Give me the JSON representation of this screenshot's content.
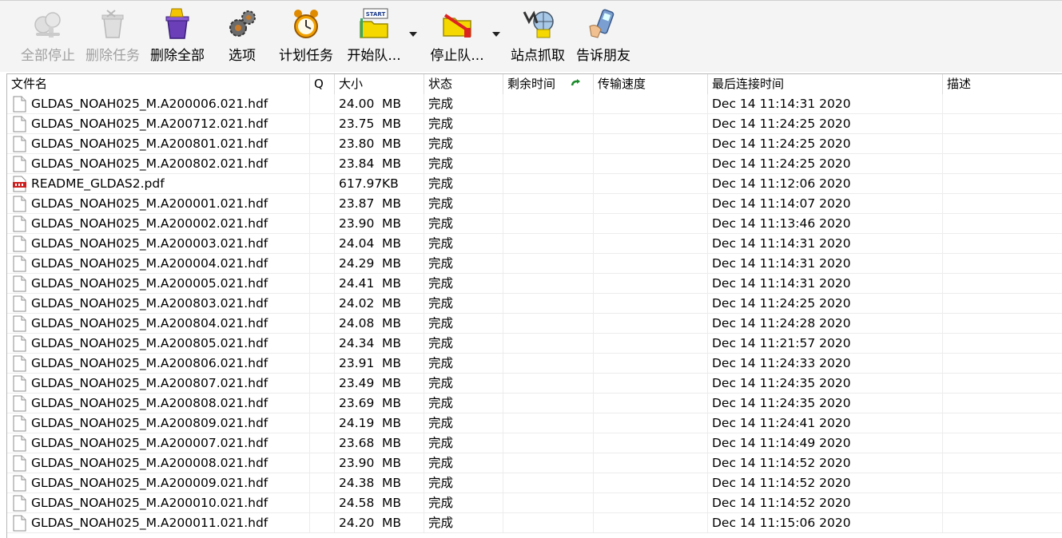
{
  "toolbar": {
    "buttons": [
      {
        "label": "全部停止",
        "icon": "stop-all-icon",
        "disabled": true
      },
      {
        "label": "删除任务",
        "icon": "delete-task-icon",
        "disabled": true
      },
      {
        "label": "删除全部",
        "icon": "delete-all-icon",
        "disabled": false
      },
      {
        "label": "选项",
        "icon": "options-gear-icon",
        "disabled": false
      },
      {
        "label": "计划任务",
        "icon": "scheduler-clock-icon",
        "disabled": false
      },
      {
        "label": "开始队...",
        "icon": "start-queue-icon",
        "disabled": false
      },
      {
        "label": "停止队...",
        "icon": "stop-queue-icon",
        "disabled": false
      },
      {
        "label": "站点抓取",
        "icon": "site-grabber-icon",
        "disabled": false
      },
      {
        "label": "告诉朋友",
        "icon": "tell-friend-icon",
        "disabled": false
      }
    ],
    "start_icon_text": "START"
  },
  "table": {
    "headers": {
      "name": "文件名",
      "q": "Q",
      "size": "大小",
      "status": "状态",
      "remaining": "剩余时间",
      "speed": "传输速度",
      "last": "最后连接时间",
      "desc": "描述"
    },
    "rows": [
      {
        "name": "GLDAS_NOAH025_M.A200006.021.hdf",
        "type": "file",
        "size": "24.00",
        "unit": "MB",
        "status": "完成",
        "last": "Dec 14 11:14:31 2020"
      },
      {
        "name": "GLDAS_NOAH025_M.A200712.021.hdf",
        "type": "file",
        "size": "23.75",
        "unit": "MB",
        "status": "完成",
        "last": "Dec 14 11:24:25 2020"
      },
      {
        "name": "GLDAS_NOAH025_M.A200801.021.hdf",
        "type": "file",
        "size": "23.80",
        "unit": "MB",
        "status": "完成",
        "last": "Dec 14 11:24:25 2020"
      },
      {
        "name": "GLDAS_NOAH025_M.A200802.021.hdf",
        "type": "file",
        "size": "23.84",
        "unit": "MB",
        "status": "完成",
        "last": "Dec 14 11:24:25 2020"
      },
      {
        "name": "README_GLDAS2.pdf",
        "type": "pdf",
        "size": "617.97",
        "unit": "KB",
        "status": "完成",
        "last": "Dec 14 11:12:06 2020"
      },
      {
        "name": "GLDAS_NOAH025_M.A200001.021.hdf",
        "type": "file",
        "size": "23.87",
        "unit": "MB",
        "status": "完成",
        "last": "Dec 14 11:14:07 2020"
      },
      {
        "name": "GLDAS_NOAH025_M.A200002.021.hdf",
        "type": "file",
        "size": "23.90",
        "unit": "MB",
        "status": "完成",
        "last": "Dec 14 11:13:46 2020"
      },
      {
        "name": "GLDAS_NOAH025_M.A200003.021.hdf",
        "type": "file",
        "size": "24.04",
        "unit": "MB",
        "status": "完成",
        "last": "Dec 14 11:14:31 2020"
      },
      {
        "name": "GLDAS_NOAH025_M.A200004.021.hdf",
        "type": "file",
        "size": "24.29",
        "unit": "MB",
        "status": "完成",
        "last": "Dec 14 11:14:31 2020"
      },
      {
        "name": "GLDAS_NOAH025_M.A200005.021.hdf",
        "type": "file",
        "size": "24.41",
        "unit": "MB",
        "status": "完成",
        "last": "Dec 14 11:14:31 2020"
      },
      {
        "name": "GLDAS_NOAH025_M.A200803.021.hdf",
        "type": "file",
        "size": "24.02",
        "unit": "MB",
        "status": "完成",
        "last": "Dec 14 11:24:25 2020"
      },
      {
        "name": "GLDAS_NOAH025_M.A200804.021.hdf",
        "type": "file",
        "size": "24.08",
        "unit": "MB",
        "status": "完成",
        "last": "Dec 14 11:24:28 2020"
      },
      {
        "name": "GLDAS_NOAH025_M.A200805.021.hdf",
        "type": "file",
        "size": "24.34",
        "unit": "MB",
        "status": "完成",
        "last": "Dec 14 11:21:57 2020"
      },
      {
        "name": "GLDAS_NOAH025_M.A200806.021.hdf",
        "type": "file",
        "size": "23.91",
        "unit": "MB",
        "status": "完成",
        "last": "Dec 14 11:24:33 2020"
      },
      {
        "name": "GLDAS_NOAH025_M.A200807.021.hdf",
        "type": "file",
        "size": "23.49",
        "unit": "MB",
        "status": "完成",
        "last": "Dec 14 11:24:35 2020"
      },
      {
        "name": "GLDAS_NOAH025_M.A200808.021.hdf",
        "type": "file",
        "size": "23.69",
        "unit": "MB",
        "status": "完成",
        "last": "Dec 14 11:24:35 2020"
      },
      {
        "name": "GLDAS_NOAH025_M.A200809.021.hdf",
        "type": "file",
        "size": "24.19",
        "unit": "MB",
        "status": "完成",
        "last": "Dec 14 11:24:41 2020"
      },
      {
        "name": "GLDAS_NOAH025_M.A200007.021.hdf",
        "type": "file",
        "size": "23.68",
        "unit": "MB",
        "status": "完成",
        "last": "Dec 14 11:14:49 2020"
      },
      {
        "name": "GLDAS_NOAH025_M.A200008.021.hdf",
        "type": "file",
        "size": "23.90",
        "unit": "MB",
        "status": "完成",
        "last": "Dec 14 11:14:52 2020"
      },
      {
        "name": "GLDAS_NOAH025_M.A200009.021.hdf",
        "type": "file",
        "size": "24.38",
        "unit": "MB",
        "status": "完成",
        "last": "Dec 14 11:14:52 2020"
      },
      {
        "name": "GLDAS_NOAH025_M.A200010.021.hdf",
        "type": "file",
        "size": "24.58",
        "unit": "MB",
        "status": "完成",
        "last": "Dec 14 11:14:52 2020"
      },
      {
        "name": "GLDAS_NOAH025_M.A200011.021.hdf",
        "type": "file",
        "size": "24.20",
        "unit": "MB",
        "status": "完成",
        "last": "Dec 14 11:15:06 2020"
      }
    ]
  },
  "colors": {
    "toolbar_bg": "#f4f4f4",
    "disabled_text": "#a0a0a0",
    "pdf_red": "#cc1f1f"
  }
}
